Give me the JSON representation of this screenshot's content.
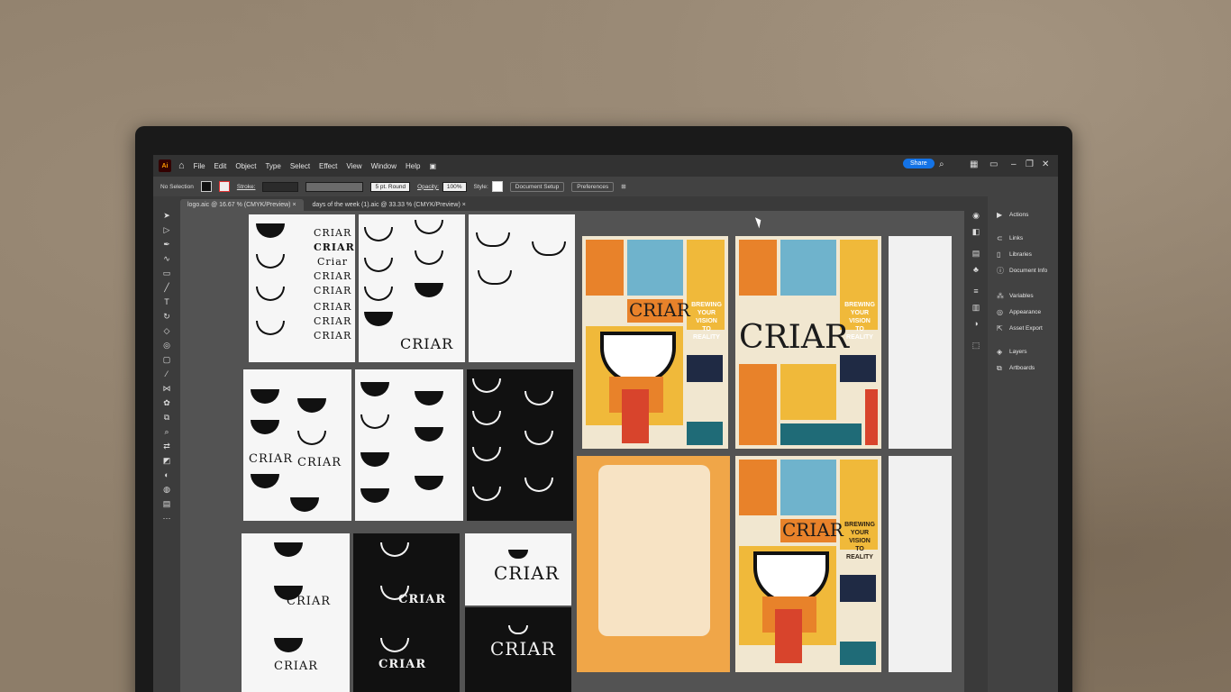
{
  "menu": {
    "app_badge": "Ai",
    "items": [
      "File",
      "Edit",
      "Object",
      "Type",
      "Select",
      "Effect",
      "View",
      "Window",
      "Help"
    ],
    "share_label": "Share"
  },
  "control": {
    "selection_label": "No Selection",
    "stroke_label": "Stroke:",
    "brush_label": "5 pt. Round",
    "opacity_label": "Opacity:",
    "opacity_value": "100%",
    "style_label": "Style:",
    "document_setup": "Document Setup",
    "preferences": "Preferences"
  },
  "tabs": [
    {
      "label": "logo.aic @ 16.67 % (CMYK/Preview)"
    },
    {
      "label": "days of the week (1).aic @ 33.33 % (CMYK/Preview)"
    }
  ],
  "panel": {
    "items": [
      "Actions",
      "Links",
      "Libraries",
      "Document Info",
      "Variables",
      "Appearance",
      "Asset Export",
      "Layers",
      "Artboards"
    ]
  },
  "artboards": {
    "wordmarks": [
      "CRIAR",
      "CRIAR",
      "Criar",
      "CRIAR",
      "CRIAR",
      "CRIAR",
      "CRIAR",
      "CRIAR"
    ],
    "criar": "CRIAR",
    "tagline": [
      "BREWING",
      "YOUR",
      "VISION",
      "TO",
      "REALITY"
    ]
  },
  "colors": {
    "orange": "#e8822a",
    "blue": "#6fb3cc",
    "yellow": "#f0b93a",
    "navy": "#1f2a44",
    "red": "#d8442c",
    "teal": "#1f6b77"
  }
}
